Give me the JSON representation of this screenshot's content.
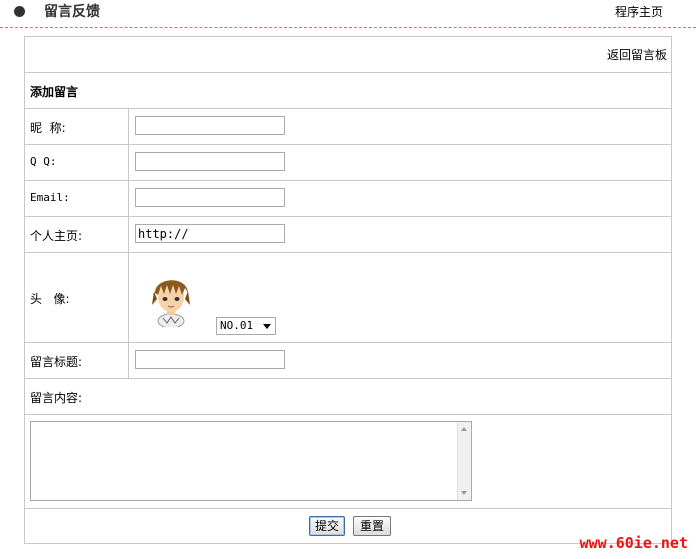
{
  "header": {
    "title": "留言反馈",
    "home_link": "程序主页"
  },
  "form": {
    "back_link": "返回留言板",
    "heading": "添加留言",
    "nickname": {
      "label": "昵  称:",
      "value": ""
    },
    "qq": {
      "label": "Q Q:",
      "value": ""
    },
    "email": {
      "label": "Email:",
      "value": ""
    },
    "homepage": {
      "label": "个人主页:",
      "value": "http://"
    },
    "avatar": {
      "label": "头   像:",
      "selected": "NO.01"
    },
    "subject": {
      "label": "留言标题:",
      "value": ""
    },
    "content": {
      "label": "留言内容:",
      "value": ""
    },
    "submit_label": "提交",
    "reset_label": "重置"
  },
  "watermark": "www.60ie.net",
  "colors": {
    "border": "#c8c8c8",
    "divider_dashed": "#6aa86a",
    "watermark": "#ee1111"
  }
}
